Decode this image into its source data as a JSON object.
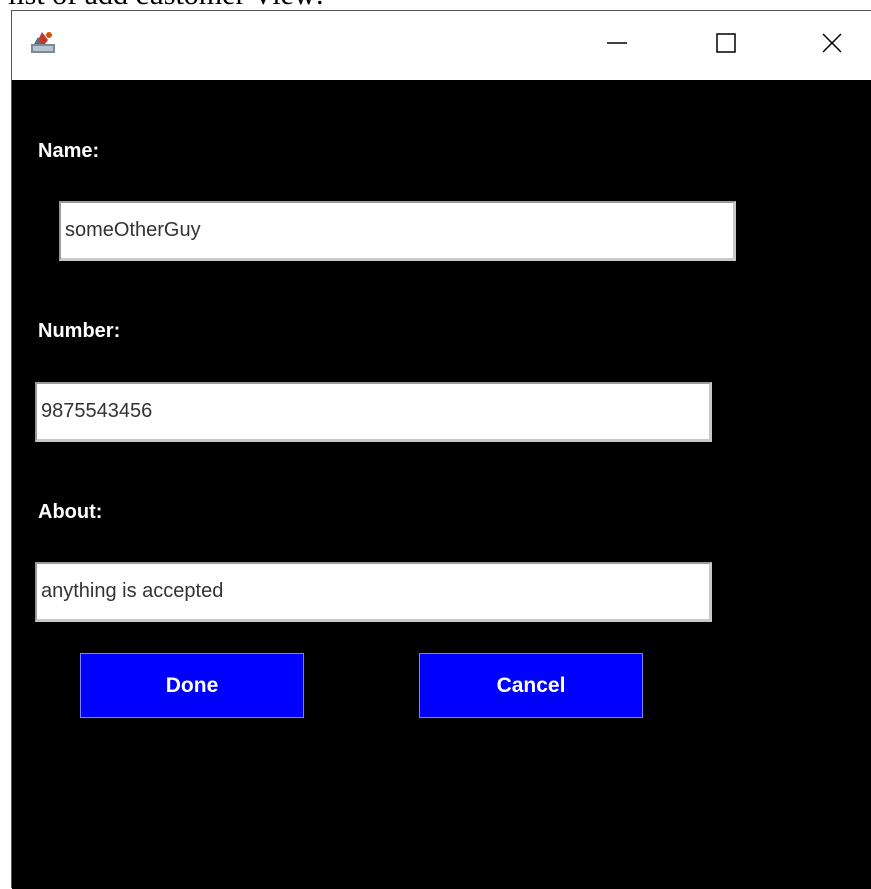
{
  "caption": "list of add customer View:",
  "window": {
    "icons": {
      "app": "java-app-icon",
      "minimize": "minimize-icon",
      "maximize": "maximize-icon",
      "close": "close-icon"
    }
  },
  "form": {
    "name_label": "Name:",
    "name_value": "someOtherGuy",
    "number_label": "Number:",
    "number_value": "9875543456",
    "about_label": "About:",
    "about_value": "anything is accepted"
  },
  "buttons": {
    "done_label": "Done",
    "cancel_label": "Cancel"
  },
  "colors": {
    "background": "#000000",
    "button": "#0000ff",
    "label": "#ffffff"
  }
}
